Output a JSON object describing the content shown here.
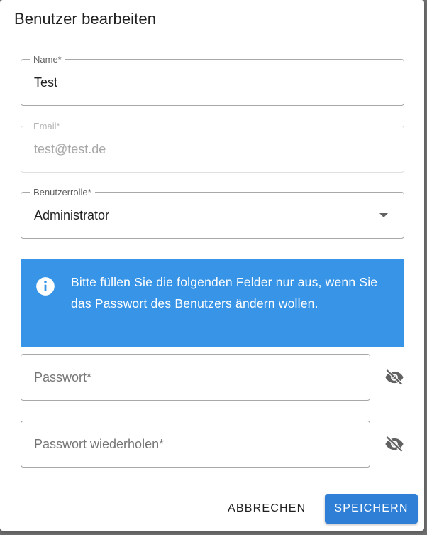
{
  "dialog": {
    "title": "Benutzer bearbeiten"
  },
  "fields": {
    "name": {
      "label": "Name*",
      "value": "Test"
    },
    "email": {
      "label": "Email*",
      "value": "test@test.de"
    },
    "role": {
      "label": "Benutzerrolle*",
      "value": "Administrator"
    }
  },
  "info": {
    "icon": "info-icon",
    "text": "Bitte füllen Sie die folgenden Felder nur aus, wenn Sie das Passwort des Benutzers ändern wollen."
  },
  "password": {
    "placeholder": "Passwort*",
    "icon": "eye-off-icon"
  },
  "password_repeat": {
    "placeholder": "Passwort wiederholen*",
    "icon": "eye-off-icon"
  },
  "actions": {
    "cancel_label": "ABBRECHEN",
    "save_label": "SPEICHERN"
  },
  "colors": {
    "primary": "#2f7fd6",
    "info": "#3794e6"
  }
}
